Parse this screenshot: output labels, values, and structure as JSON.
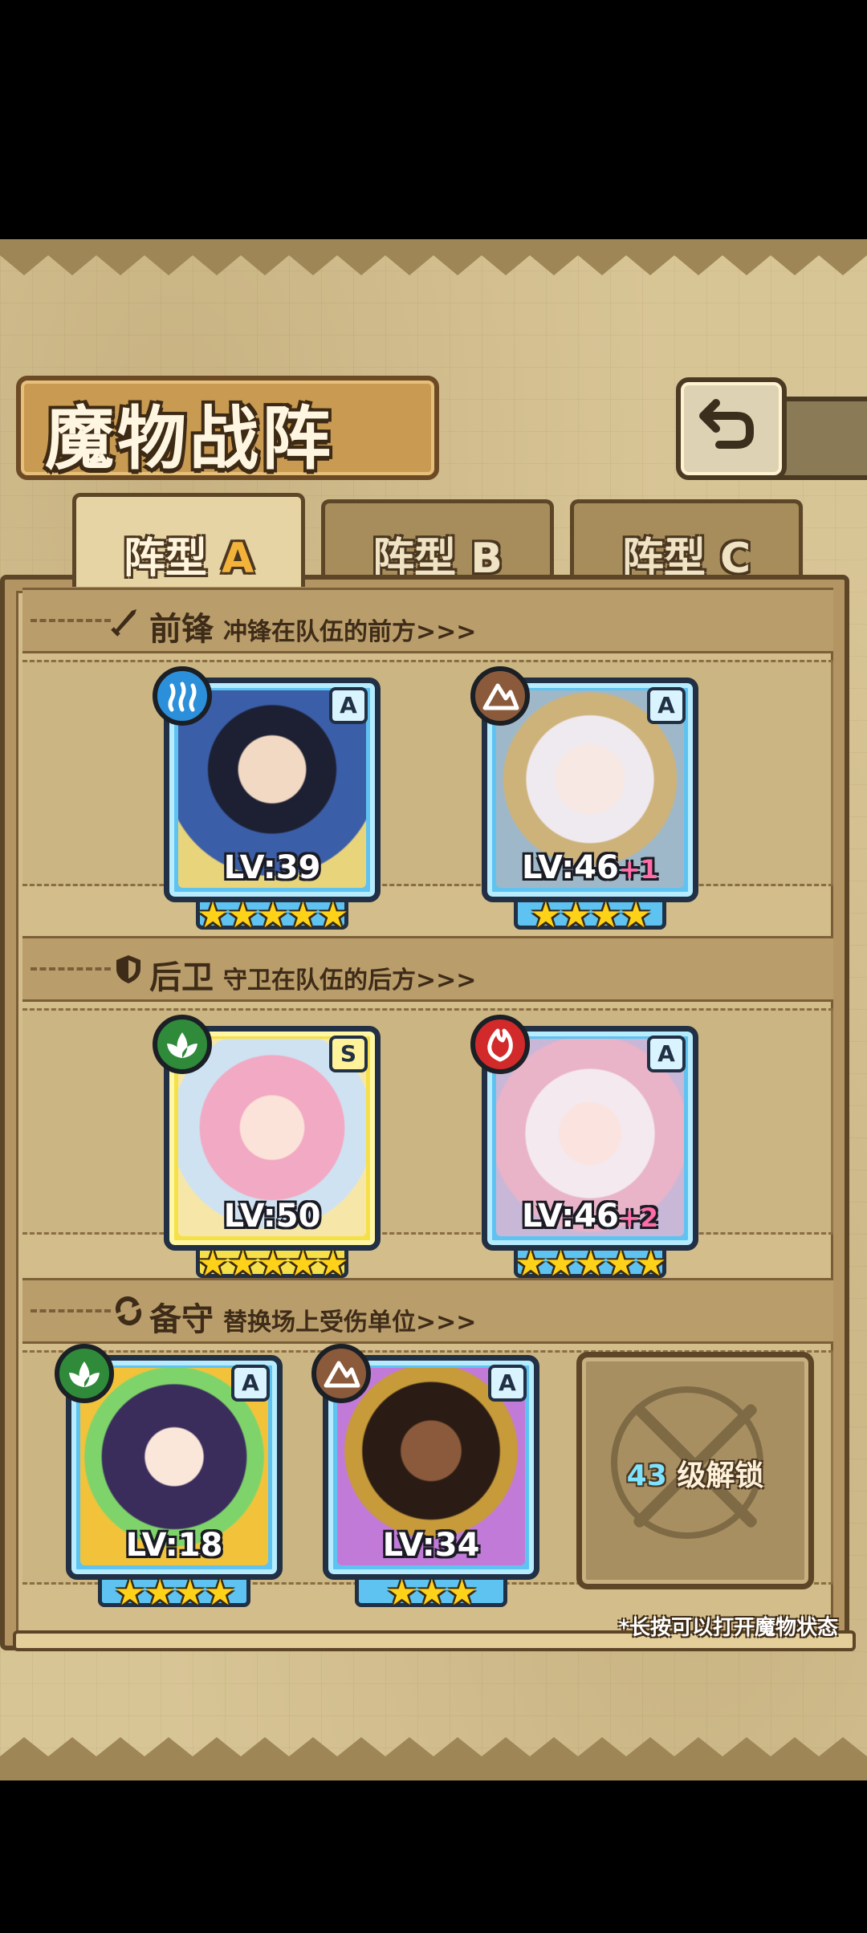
{
  "header": {
    "title": "魔物战阵",
    "back_icon": "return-arrow-icon"
  },
  "tabs": [
    {
      "label": "阵型",
      "suffix": "A",
      "active": true
    },
    {
      "label": "阵型",
      "suffix": "B",
      "active": false
    },
    {
      "label": "阵型",
      "suffix": "C",
      "active": false
    }
  ],
  "sections": {
    "front": {
      "title": "前锋",
      "desc": "冲锋在队伍的前方>>>",
      "icon": "sword-icon"
    },
    "back": {
      "title": "后卫",
      "desc": "守卫在队伍的后方>>>",
      "icon": "shield-icon"
    },
    "reserve": {
      "title": "备守",
      "desc": "替换场上受伤单位>>>",
      "icon": "swap-icon"
    }
  },
  "cards": {
    "front1": {
      "level": "LV:39",
      "bonus": "",
      "rank": "A",
      "element": "water",
      "element_color": "#2b8fd9",
      "stars": 5
    },
    "front2": {
      "level": "LV:46",
      "bonus": "+1",
      "rank": "A",
      "element": "earth",
      "element_color": "#8a5a3a",
      "stars": 4
    },
    "back1": {
      "level": "LV:50",
      "bonus": "",
      "rank": "S",
      "element": "wind",
      "element_color": "#2f8a3a",
      "stars": 5
    },
    "back2": {
      "level": "LV:46",
      "bonus": "+2",
      "rank": "A",
      "element": "fire",
      "element_color": "#d22a2a",
      "stars": 5
    },
    "res1": {
      "level": "LV:18",
      "bonus": "",
      "rank": "A",
      "element": "wind",
      "element_color": "#2f8a3a",
      "stars": 4
    },
    "res2": {
      "level": "LV:34",
      "bonus": "",
      "rank": "A",
      "element": "earth",
      "element_color": "#8a5a3a",
      "stars": 3
    }
  },
  "stars_text": {
    "five": "★★★★★",
    "four": "★★★★",
    "three": "★★★"
  },
  "locked_slot": {
    "level": "43",
    "label": "级解锁"
  },
  "footnote": "*长按可以打开魔物状态"
}
